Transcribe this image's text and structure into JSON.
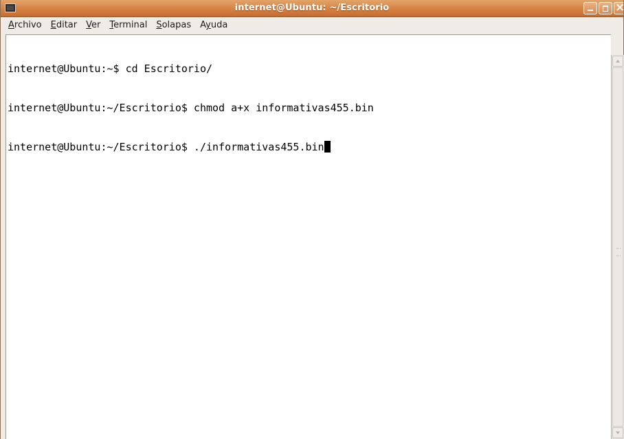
{
  "window": {
    "title": "internet@Ubuntu: ~/Escritorio",
    "app_icon": "terminal-icon",
    "controls": [
      "minimize-icon",
      "maximize-icon",
      "close-icon"
    ]
  },
  "menubar": {
    "items": [
      {
        "mnemonic": "A",
        "rest": "rchivo"
      },
      {
        "mnemonic": "E",
        "rest": "ditar"
      },
      {
        "mnemonic": "V",
        "rest": "er"
      },
      {
        "mnemonic": "T",
        "rest": "erminal"
      },
      {
        "mnemonic": "S",
        "rest": "olapas"
      },
      {
        "pre": "A",
        "mnemonic": "y",
        "rest": "uda"
      }
    ]
  },
  "terminal": {
    "lines": [
      "internet@Ubuntu:~$ cd Escritorio/",
      "internet@Ubuntu:~/Escritorio$ chmod a+x informativas455.bin",
      "internet@Ubuntu:~/Escritorio$ ./informativas455.bin"
    ]
  },
  "colors": {
    "titlebar": "#d8874a",
    "background": "#ffffff",
    "foreground": "#000000"
  }
}
